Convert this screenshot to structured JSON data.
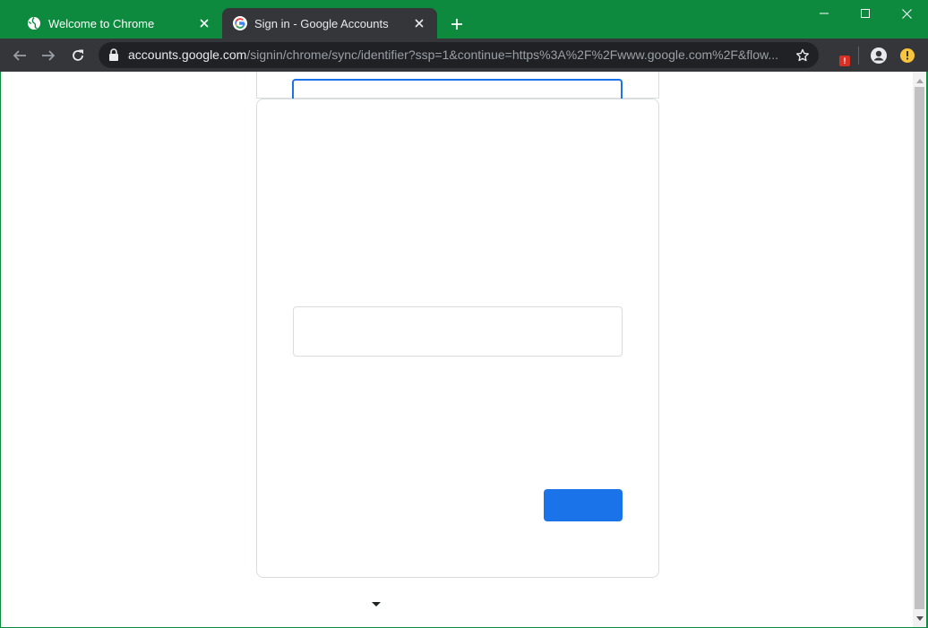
{
  "browser": {
    "tabs": [
      {
        "title": "Welcome to Chrome",
        "icon": "globe-icon",
        "active": false
      },
      {
        "title": "Sign in - Google Accounts",
        "icon": "google-g-icon",
        "active": true
      }
    ],
    "address": {
      "host": "accounts.google.com",
      "path": "/signin/chrome/sync/identifier?ssp=1&continue=https%3A%2F%2Fwww.google.com%2F&flow..."
    },
    "extension_badge": "!"
  },
  "colors": {
    "frame": "#0d8a3e",
    "toolbar": "#35363a",
    "omnibox": "#202124",
    "accent": "#1a73e8"
  }
}
